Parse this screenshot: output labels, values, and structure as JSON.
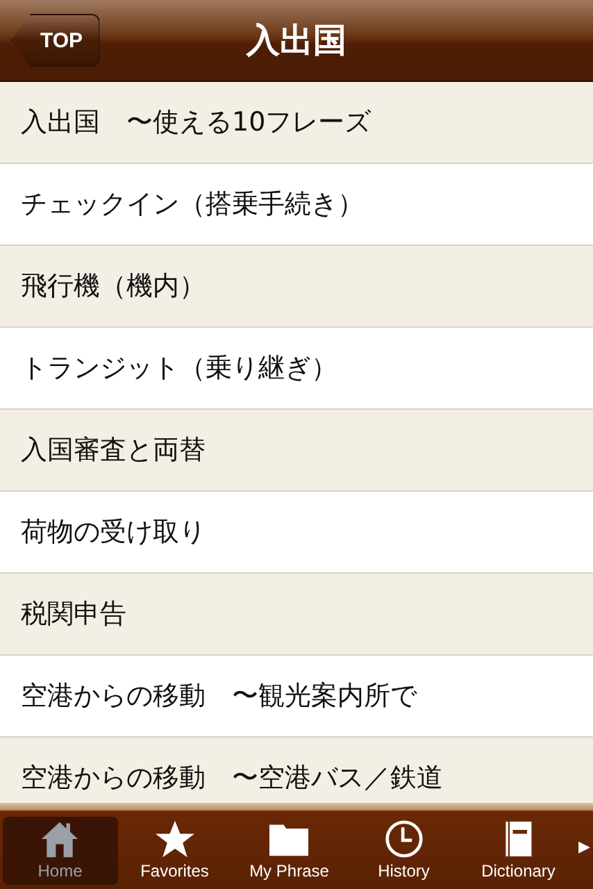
{
  "nav_bar": {
    "back_button": "TOP",
    "title": "入出国"
  },
  "items": [
    {
      "label": "入出国　〜使える10フレーズ"
    },
    {
      "label": "チェックイン（搭乗手続き）"
    },
    {
      "label": "飛行機（機内）"
    },
    {
      "label": "トランジット（乗り継ぎ）"
    },
    {
      "label": "入国審査と両替"
    },
    {
      "label": "荷物の受け取り"
    },
    {
      "label": "税関申告"
    },
    {
      "label": "空港からの移動　〜観光案内所で"
    },
    {
      "label": "空港からの移動　〜空港バス／鉄道"
    }
  ],
  "tab_bar": {
    "tabs": [
      {
        "label": "Home",
        "kind": "home",
        "selected": true
      },
      {
        "label": "Favorites",
        "kind": "star",
        "selected": false
      },
      {
        "label": "My Phrase",
        "kind": "folder",
        "selected": false
      },
      {
        "label": "History",
        "kind": "clock",
        "selected": false
      },
      {
        "label": "Dictionary",
        "kind": "book",
        "selected": false
      }
    ],
    "more_arrow": "▶"
  }
}
